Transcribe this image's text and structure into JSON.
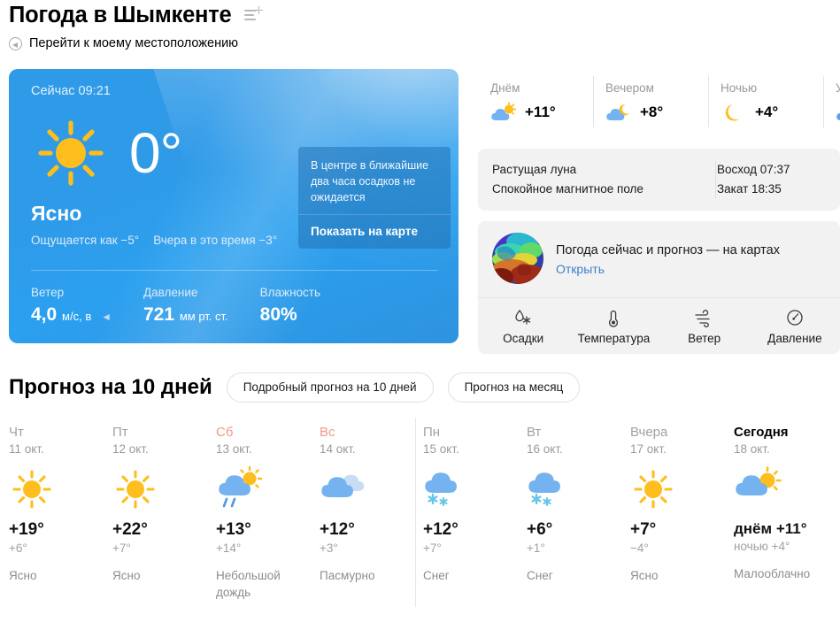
{
  "header": {
    "title": "Погода в Шымкенте",
    "add_list_icon": "list-add-icon",
    "geo_icon": "location-arrow-icon",
    "geo_link": "Перейти к моему местоположению"
  },
  "now": {
    "time_label": "Сейчас 09:21",
    "temperature": "0°",
    "icon": "sun-icon",
    "condition": "Ясно",
    "feels_like": "Ощущается как −5°",
    "yesterday": "Вчера в это время −3°",
    "stats": [
      {
        "label": "Ветер",
        "value": "4,0",
        "unit": "м/с, в",
        "arrow": "◄"
      },
      {
        "label": "Давление",
        "value": "721",
        "unit": "мм рт. ст.",
        "arrow": ""
      },
      {
        "label": "Влажность",
        "value": "80%",
        "unit": "",
        "arrow": ""
      }
    ],
    "tip": {
      "text": "В центре в ближайшие два часа осадков не ожидается",
      "map_link": "Показать на карте"
    }
  },
  "day_parts": [
    {
      "label": "Днём",
      "icon": "sun-behind-cloud-icon",
      "temp": "+11°"
    },
    {
      "label": "Вечером",
      "icon": "moon-behind-cloud-icon",
      "temp": "+8°"
    },
    {
      "label": "Ночью",
      "icon": "moon-icon",
      "temp": "+4°"
    },
    {
      "label": "У",
      "icon": "cloud-icon",
      "temp": ""
    }
  ],
  "astro": {
    "moon_phase": "Растущая луна",
    "magnetic": "Спокойное магнитное поле",
    "sunrise": "Восход 07:37",
    "sunset": "Закат 18:35"
  },
  "maps": {
    "thumb_icon": "weather-globe-icon",
    "title": "Погода сейчас и прогноз — на картах",
    "link": "Открыть",
    "layers": [
      {
        "icon": "precipitation-icon",
        "label": "Осадки"
      },
      {
        "icon": "thermometer-icon",
        "label": "Температура"
      },
      {
        "icon": "wind-icon",
        "label": "Ветер"
      },
      {
        "icon": "gauge-icon",
        "label": "Давление"
      }
    ]
  },
  "forecast": {
    "title": "Прогноз на 10 дней",
    "buttons": [
      "Подробный прогноз на 10 дней",
      "Прогноз на месяц"
    ],
    "days": [
      {
        "dow": "Чт",
        "date": "11 окт.",
        "icon": "sun-icon",
        "tmax": "+19°",
        "tmin": "+6°",
        "cond": "Ясно",
        "style": "past",
        "divider": false
      },
      {
        "dow": "Пт",
        "date": "12 окт.",
        "icon": "sun-icon",
        "tmax": "+22°",
        "tmin": "+7°",
        "cond": "Ясно",
        "style": "past",
        "divider": false
      },
      {
        "dow": "Сб",
        "date": "13 окт.",
        "icon": "sun-cloud-rain-icon",
        "tmax": "+13°",
        "tmin": "+14°",
        "cond": "Небольшой дождь",
        "style": "weekend",
        "divider": false
      },
      {
        "dow": "Вс",
        "date": "14 окт.",
        "icon": "cloud-overcast-icon",
        "tmax": "+12°",
        "tmin": "+3°",
        "cond": "Пасмурно",
        "style": "weekend",
        "divider": false
      },
      {
        "dow": "Пн",
        "date": "15 окт.",
        "icon": "cloud-snow-icon",
        "tmax": "+12°",
        "tmin": "+7°",
        "cond": "Снег",
        "style": "past",
        "divider": true
      },
      {
        "dow": "Вт",
        "date": "16 окт.",
        "icon": "cloud-snow-icon",
        "tmax": "+6°",
        "tmin": "+1°",
        "cond": "Снег",
        "style": "past",
        "divider": false
      },
      {
        "dow": "Вчера",
        "date": "17 окт.",
        "icon": "sun-icon",
        "tmax": "+7°",
        "tmin": "−4°",
        "cond": "Ясно",
        "style": "past",
        "divider": false
      },
      {
        "dow": "Сегодня",
        "date": "18 окт.",
        "icon": "sun-behind-cloud-icon",
        "tmax": "днём +11°",
        "tmin": "ночью +4°",
        "cond": "Малооблачно",
        "style": "today",
        "divider": false
      }
    ]
  },
  "colors": {
    "card_blue": "#2f9ae8",
    "sun_yellow": "#fdbe1e",
    "cloud_blue": "#74b3f0",
    "snow_blue": "#63c6e8",
    "weekend_red": "#f09a8b",
    "link_blue": "#3f7fcc"
  }
}
